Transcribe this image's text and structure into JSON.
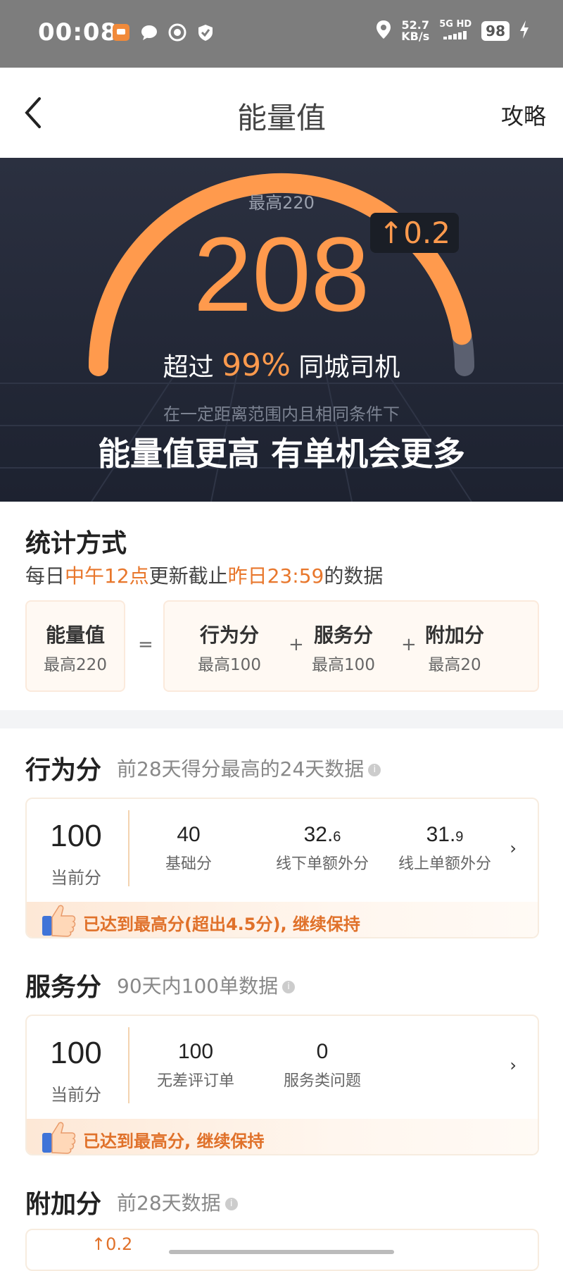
{
  "status_bar": {
    "time": "00:08",
    "speed_value": "52.7",
    "speed_unit": "KB/s",
    "network": "5G HD",
    "battery": "98"
  },
  "nav": {
    "title": "能量值",
    "guide": "攻略"
  },
  "hero": {
    "max_label": "最高220",
    "score": "208",
    "delta": "↑0.2",
    "beat_prefix": "超过",
    "beat_pct": "99%",
    "beat_suffix": "同城司机",
    "note": "在一定距离范围内且相同条件下",
    "slogan": "能量值更高 有单机会更多",
    "gauge_fraction": 0.945
  },
  "stats": {
    "title": "统计方式",
    "sub_1": "每日",
    "sub_2": "中午12点",
    "sub_3": "更新截止",
    "sub_4": "昨日23:59",
    "sub_5": "的数据",
    "formula": {
      "total_title": "能量值",
      "total_max": "最高220",
      "eq": "=",
      "plus": "+",
      "parts": [
        {
          "title": "行为分",
          "max": "最高100"
        },
        {
          "title": "服务分",
          "max": "最高100"
        },
        {
          "title": "附加分",
          "max": "最高20"
        }
      ]
    }
  },
  "behavior": {
    "title": "行为分",
    "sub": "前28天得分最高的24天数据",
    "current": "100",
    "current_label": "当前分",
    "metrics": [
      {
        "int": "40",
        "dec": "",
        "label": "基础分"
      },
      {
        "int": "32.",
        "dec": "6",
        "label": "线下单额外分"
      },
      {
        "int": "31.",
        "dec": "9",
        "label": "线上单额外分"
      }
    ],
    "message": "已达到最高分(超出4.5分), 继续保持"
  },
  "service": {
    "title": "服务分",
    "sub": "90天内100单数据",
    "current": "100",
    "current_label": "当前分",
    "metrics": [
      {
        "int": "100",
        "label": "无差评订单"
      },
      {
        "int": "0",
        "label": "服务类问题"
      }
    ],
    "message": "已达到最高分, 继续保持"
  },
  "extra": {
    "title": "附加分",
    "sub": "前28天数据",
    "delta": "↑0.2"
  },
  "colors": {
    "accent": "#ff9a4d",
    "accent_text": "#e8772c",
    "hero_bg": "#232836"
  },
  "icons": {
    "back": "chevron-left-icon",
    "info": "info-icon",
    "chevron": "chevron-right-icon",
    "thumb": "thumbs-up-icon"
  }
}
